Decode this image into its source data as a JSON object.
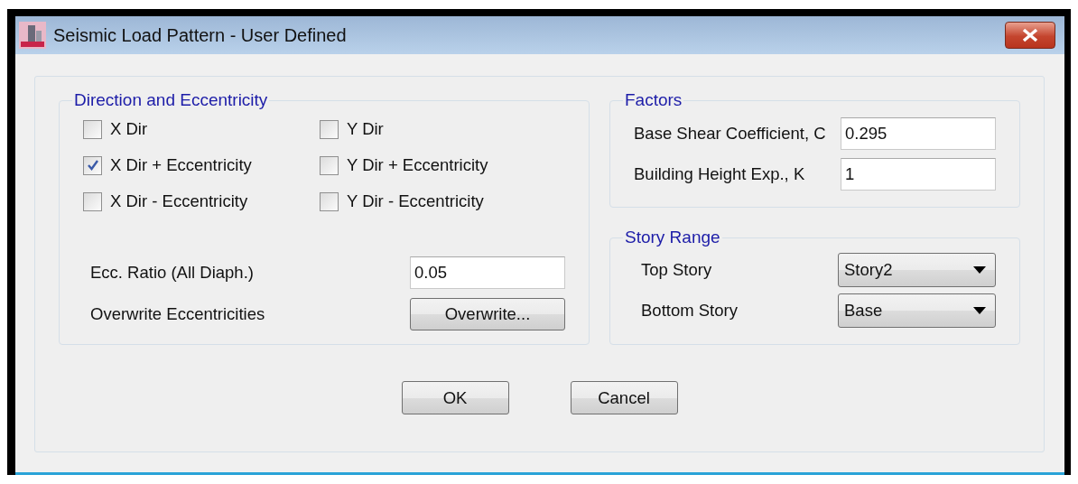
{
  "window": {
    "title": "Seismic Load Pattern - User Defined"
  },
  "direction_group": {
    "title": "Direction and Eccentricity",
    "checkboxes": [
      {
        "label": "X Dir",
        "checked": false
      },
      {
        "label": "Y Dir",
        "checked": false
      },
      {
        "label": "X Dir + Eccentricity",
        "checked": true
      },
      {
        "label": "Y Dir + Eccentricity",
        "checked": false
      },
      {
        "label": "X Dir - Eccentricity",
        "checked": false
      },
      {
        "label": "Y Dir - Eccentricity",
        "checked": false
      }
    ],
    "rows": [
      {
        "kind": "input",
        "label": "Ecc. Ratio (All Diaph.)",
        "value": "0.05"
      },
      {
        "kind": "button",
        "label": "Overwrite Eccentricities",
        "button": "Overwrite..."
      }
    ]
  },
  "factors": {
    "title": "Factors",
    "fields": [
      {
        "label": "Base Shear Coefficient, C",
        "value": "0.295"
      },
      {
        "label": "Building Height Exp., K",
        "value": "1"
      }
    ]
  },
  "story_range": {
    "title": "Story Range",
    "fields": [
      {
        "label": "Top Story",
        "value": "Story2"
      },
      {
        "label": "Bottom Story",
        "value": "Base"
      }
    ]
  },
  "buttons": [
    "OK",
    "Cancel"
  ]
}
